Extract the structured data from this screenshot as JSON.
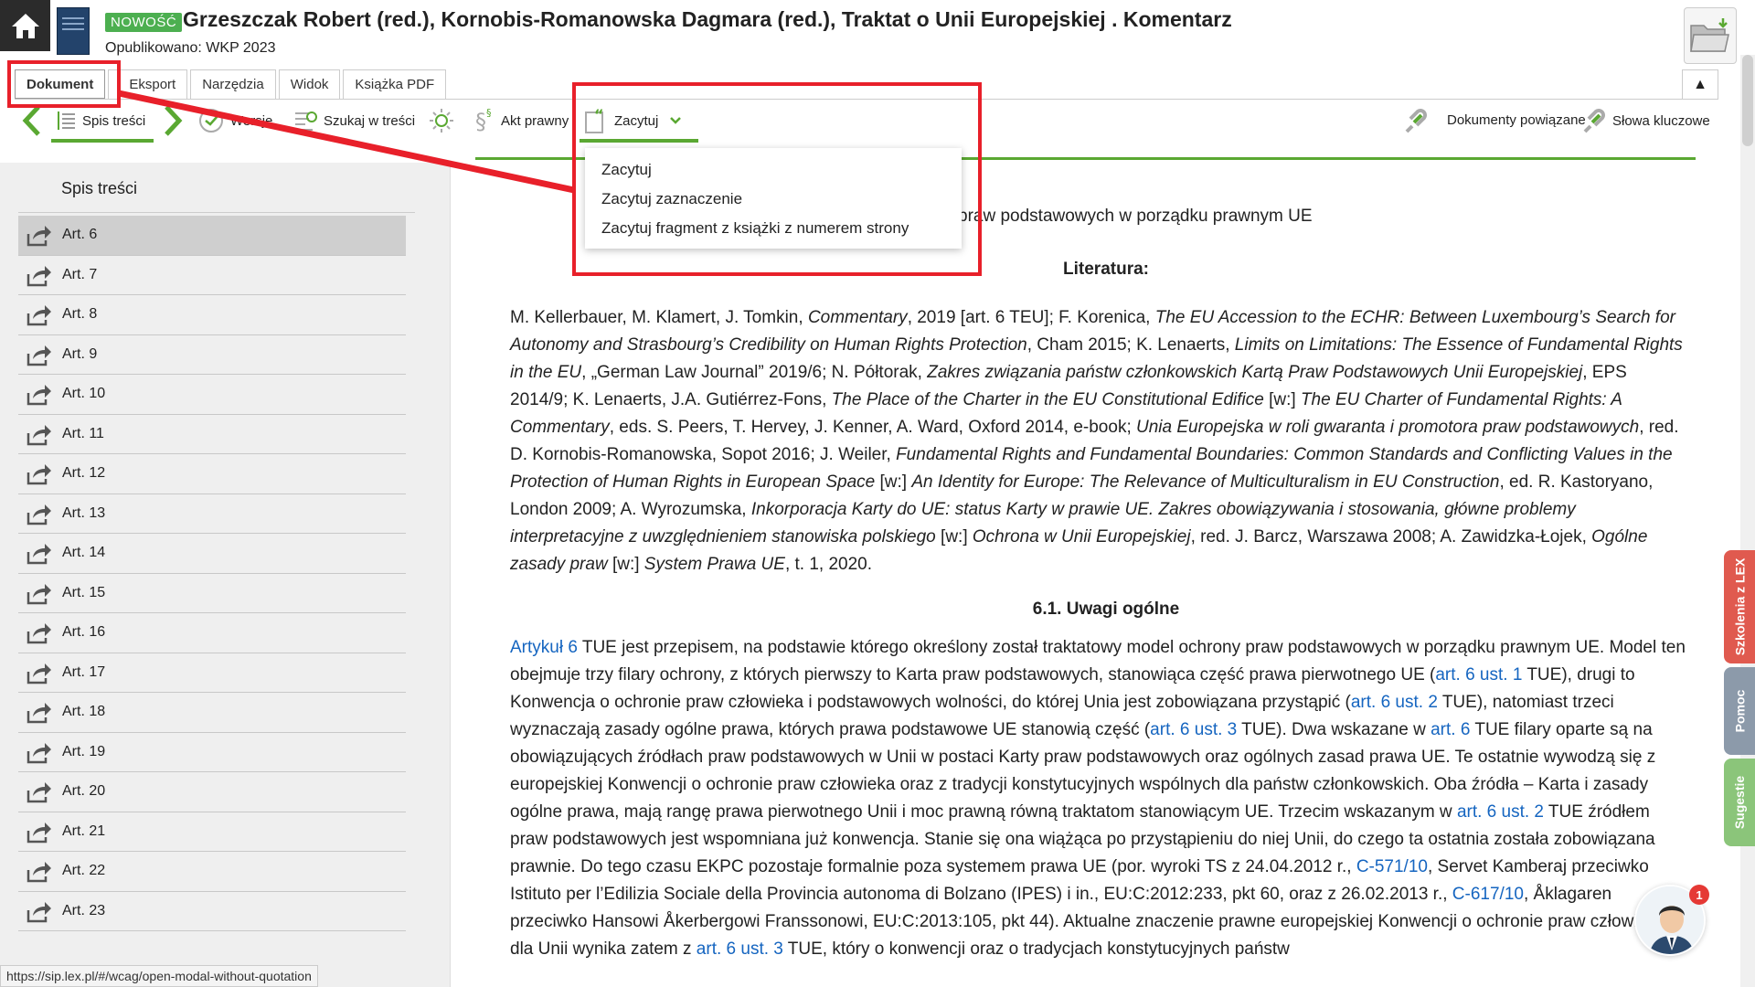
{
  "header": {
    "badge": "NOWOŚĆ",
    "title": "Grzeszczak Robert (red.), Kornobis-Romanowska Dagmara (red.),  Traktat o Unii Europejskiej . Komentarz",
    "published": "Opublikowano: WKP 2023",
    "home_icon": "home-icon",
    "folder_icon": "folder-download-icon"
  },
  "tabs": [
    {
      "label": "Dokument"
    },
    {
      "label": "Eksport"
    },
    {
      "label": "Narzędzia"
    },
    {
      "label": "Widok"
    },
    {
      "label": "Książka PDF"
    }
  ],
  "toolbar": {
    "toc": "Spis treści",
    "versions": "Wersje",
    "search": "Szukaj w treści",
    "legal_act": "Akt prawny",
    "quote": "Zacytuj",
    "related": "Dokumenty powiązane",
    "keywords": "Słowa kluczowe"
  },
  "dropdown": {
    "items": [
      "Zacytuj",
      "Zacytuj zaznaczenie",
      "Zacytuj fragment z książki z numerem strony"
    ]
  },
  "sidebar": {
    "title": "Spis treści",
    "items": [
      "Art. 6",
      "Art. 7",
      "Art. 8",
      "Art. 9",
      "Art. 10",
      "Art. 11",
      "Art. 12",
      "Art. 13",
      "Art. 14",
      "Art. 15",
      "Art. 16",
      "Art. 17",
      "Art. 18",
      "Art. 19",
      "Art. 20",
      "Art. 21",
      "Art. 22",
      "Art. 23"
    ],
    "selected_index": 0
  },
  "content": {
    "partial_heading": "praw podstawowych w porządku prawnym UE",
    "literature_heading": "Literatura:",
    "section_heading": "6.1. Uwagi ogólne"
  },
  "right_tabs": {
    "training": "Szkolenia z LEX",
    "help": "Pomoc",
    "suggestions": "Sugestie"
  },
  "status_url": "https://sip.lex.pl/#/wcag/open-modal-without-quotation",
  "avatar_badge": "1",
  "colors": {
    "accent_green": "#5aa832",
    "annotation_red": "#e8202a",
    "link_blue": "#1565c0"
  }
}
